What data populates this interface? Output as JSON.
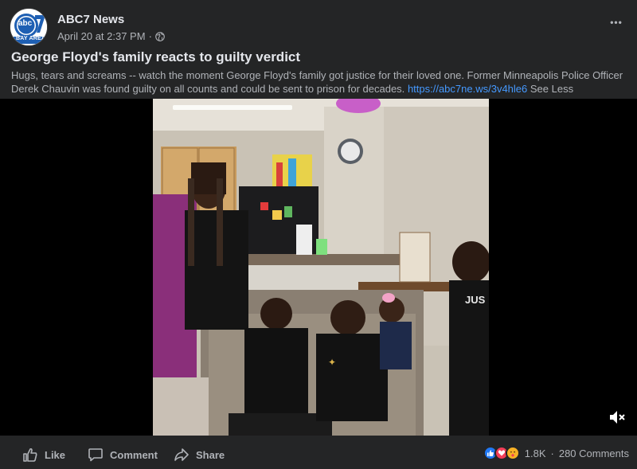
{
  "post": {
    "page_name": "ABC7 News",
    "avatar": {
      "logo_text": "abc",
      "number": "7",
      "sub": "BAY AREA"
    },
    "date": "April 20 at 2:37 PM",
    "meta_dot": "·",
    "privacy_icon": "globe-icon",
    "more_icon": "more-horiz-icon",
    "more_label": "•••",
    "title": "George Floyd's family reacts to guilty verdict",
    "description": "Hugs, tears and screams -- watch the moment George Floyd's family got justice for their loved one. Former Minneapolis Police Officer Derek Chauvin was found guilty on all counts and could be sent to prison for decades.",
    "link": "https://abc7ne.ws/3v4hle6",
    "see_less": "See Less"
  },
  "video": {
    "muted_icon": "speaker-muted-icon",
    "shirt_text": "JUS"
  },
  "actions": {
    "like": "Like",
    "comment": "Comment",
    "share": "Share"
  },
  "reactions": {
    "icons": [
      "like-icon",
      "love-icon",
      "care-icon"
    ],
    "count": "1.8K",
    "dot": "·",
    "comments": "280 Comments"
  },
  "colors": {
    "background": "#242526",
    "link": "#4599ff",
    "like_blue": "#2078f4",
    "love_red": "#f33e58",
    "care_yellow": "#f7b125"
  }
}
